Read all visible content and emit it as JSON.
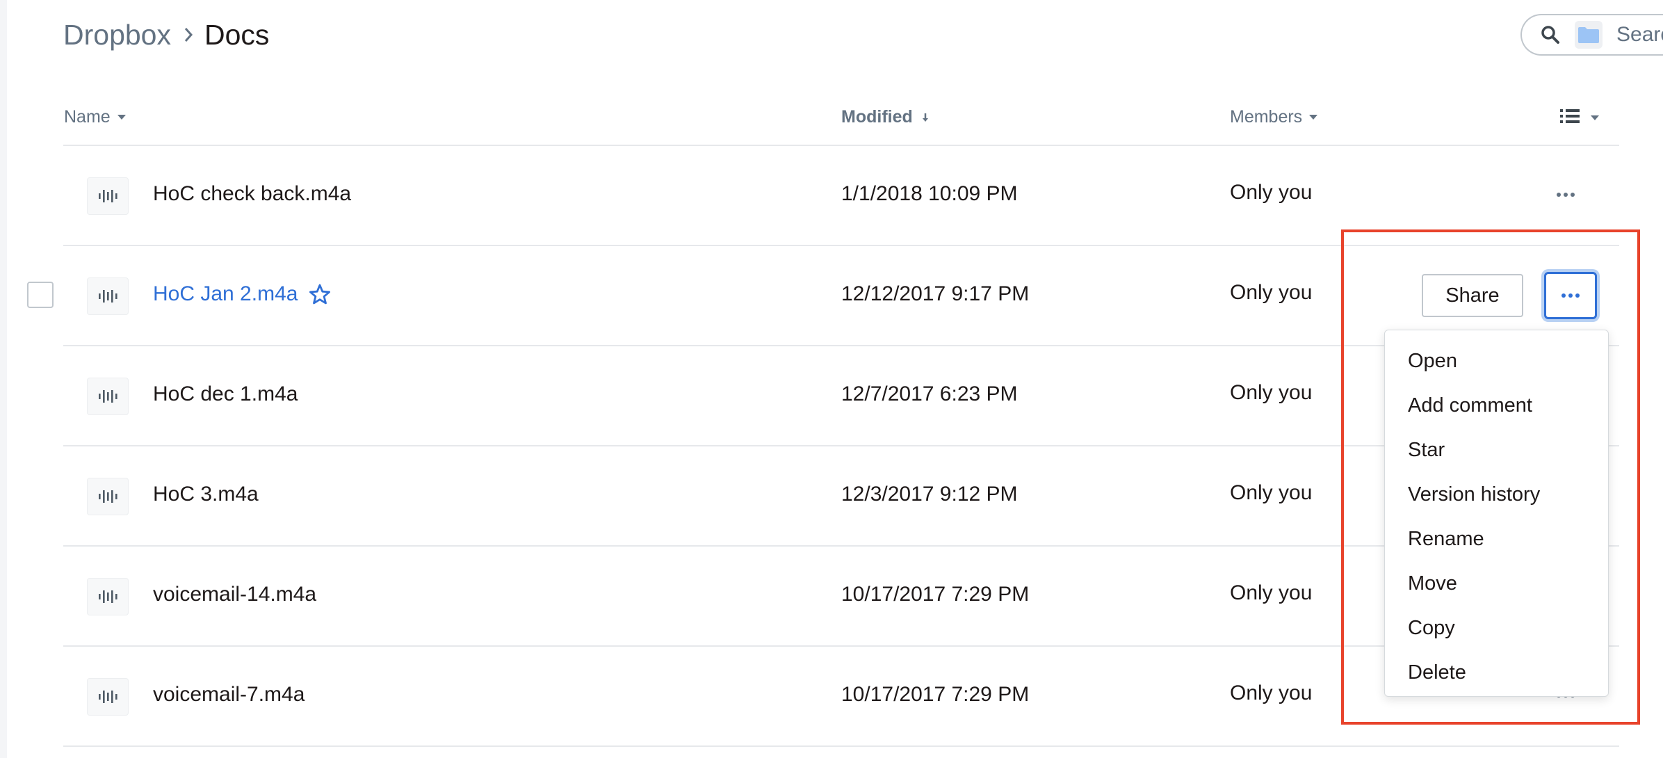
{
  "breadcrumb": {
    "root": "Dropbox",
    "current": "Docs"
  },
  "search": {
    "placeholder": "Searc"
  },
  "table": {
    "headers": {
      "name": "Name",
      "modified": "Modified",
      "members": "Members"
    },
    "rows": [
      {
        "name": "HoC check back.m4a",
        "modified": "1/1/2018 10:09 PM",
        "members": "Only you"
      },
      {
        "name": "HoC Jan 2.m4a",
        "modified": "12/12/2017 9:17 PM",
        "members": "Only you"
      },
      {
        "name": "HoC dec 1.m4a",
        "modified": "12/7/2017 6:23 PM",
        "members": "Only you"
      },
      {
        "name": "HoC 3.m4a",
        "modified": "12/3/2017 9:12 PM",
        "members": "Only you"
      },
      {
        "name": "voicemail-14.m4a",
        "modified": "10/17/2017 7:29 PM",
        "members": "Only you"
      },
      {
        "name": "voicemail-7.m4a",
        "modified": "10/17/2017 7:29 PM",
        "members": "Only you"
      }
    ]
  },
  "actions": {
    "share_label": "Share"
  },
  "context_menu": {
    "items": [
      "Open",
      "Add comment",
      "Star",
      "Version history",
      "Rename",
      "Move",
      "Copy",
      "Delete"
    ]
  },
  "colors": {
    "accent": "#2f6fd6",
    "highlight": "#e8432b",
    "muted_text": "#637282",
    "divider": "#e6e8eb"
  },
  "icons": {
    "file": "audio-waveform-icon",
    "more": "more-horizontal-icon",
    "search": "search-icon",
    "folder": "folder-icon",
    "star": "star-outline-icon",
    "list_view": "list-view-icon"
  }
}
